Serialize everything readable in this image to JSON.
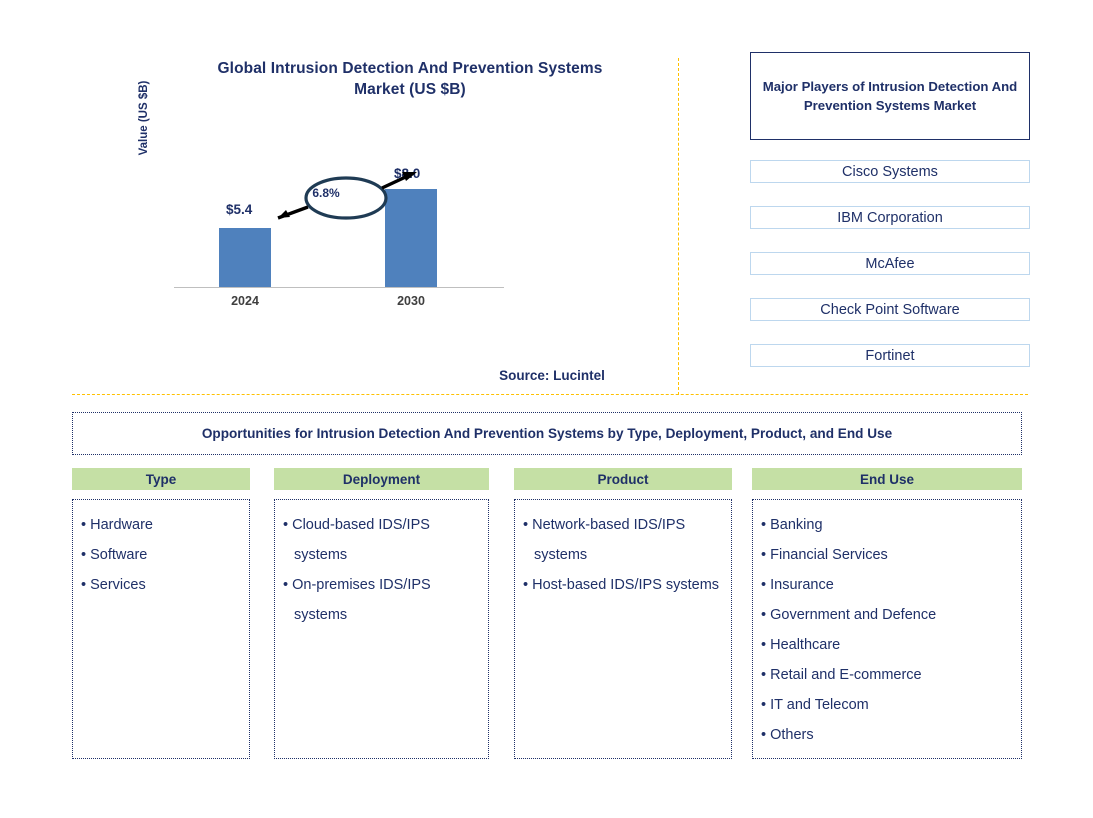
{
  "chart": {
    "title_line1": "Global Intrusion Detection And Prevention Systems",
    "title_line2": "Market (US $B)",
    "y_axis_label": "Value (US $B)",
    "cagr_label": "6.8%"
  },
  "chart_data": {
    "type": "bar",
    "title": "Global Intrusion Detection And Prevention Systems Market (US $B)",
    "categories": [
      "2024",
      "2030"
    ],
    "values": [
      5.4,
      8.0
    ],
    "value_labels": [
      "$5.4",
      "$8.0"
    ],
    "xlabel": "",
    "ylabel": "Value (US $B)",
    "ylim": [
      0,
      9.5
    ],
    "grid": false,
    "legend": "none",
    "annotations": [
      {
        "text": "6.8%",
        "meaning": "CAGR 2024-2030",
        "shape": "ellipse-with-arrow"
      }
    ],
    "bar_color": "#4F81BD"
  },
  "source": "Source: Lucintel",
  "players": {
    "header": "Major Players of Intrusion Detection And Prevention Systems Market",
    "items": [
      "Cisco Systems",
      "IBM Corporation",
      "McAfee",
      "Check Point Software",
      "Fortinet"
    ]
  },
  "opportunities": {
    "header": "Opportunities for Intrusion Detection And Prevention Systems by Type, Deployment, Product, and End Use",
    "columns": [
      {
        "title": "Type",
        "items": [
          "Hardware",
          "Software",
          "Services"
        ]
      },
      {
        "title": "Deployment",
        "items": [
          "Cloud-based IDS/IPS systems",
          "On-premises IDS/IPS systems"
        ]
      },
      {
        "title": "Product",
        "items": [
          "Network-based IDS/IPS systems",
          "Host-based IDS/IPS systems"
        ]
      },
      {
        "title": "End Use",
        "items": [
          "Banking",
          "Financial Services",
          "Insurance",
          "Government and Defence",
          "Healthcare",
          "Retail and E-commerce",
          "IT and Telecom",
          "Others"
        ]
      }
    ]
  },
  "colors": {
    "navy": "#1F3068",
    "bar_blue": "#4F81BD",
    "header_green": "#C5E0A5",
    "divider_yellow": "#FFC000",
    "player_border": "#BDD7EE"
  }
}
